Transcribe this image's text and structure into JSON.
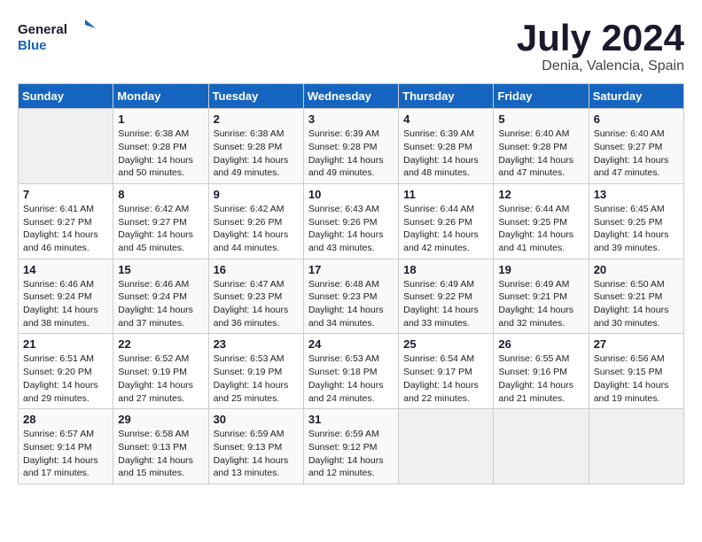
{
  "header": {
    "logo_line1": "General",
    "logo_line2": "Blue",
    "month_title": "July 2024",
    "location": "Denia, Valencia, Spain"
  },
  "weekdays": [
    "Sunday",
    "Monday",
    "Tuesday",
    "Wednesday",
    "Thursday",
    "Friday",
    "Saturday"
  ],
  "weeks": [
    [
      {
        "day": "",
        "sunrise": "",
        "sunset": "",
        "daylight": ""
      },
      {
        "day": "1",
        "sunrise": "Sunrise: 6:38 AM",
        "sunset": "Sunset: 9:28 PM",
        "daylight": "Daylight: 14 hours and 50 minutes."
      },
      {
        "day": "2",
        "sunrise": "Sunrise: 6:38 AM",
        "sunset": "Sunset: 9:28 PM",
        "daylight": "Daylight: 14 hours and 49 minutes."
      },
      {
        "day": "3",
        "sunrise": "Sunrise: 6:39 AM",
        "sunset": "Sunset: 9:28 PM",
        "daylight": "Daylight: 14 hours and 49 minutes."
      },
      {
        "day": "4",
        "sunrise": "Sunrise: 6:39 AM",
        "sunset": "Sunset: 9:28 PM",
        "daylight": "Daylight: 14 hours and 48 minutes."
      },
      {
        "day": "5",
        "sunrise": "Sunrise: 6:40 AM",
        "sunset": "Sunset: 9:28 PM",
        "daylight": "Daylight: 14 hours and 47 minutes."
      },
      {
        "day": "6",
        "sunrise": "Sunrise: 6:40 AM",
        "sunset": "Sunset: 9:27 PM",
        "daylight": "Daylight: 14 hours and 47 minutes."
      }
    ],
    [
      {
        "day": "7",
        "sunrise": "Sunrise: 6:41 AM",
        "sunset": "Sunset: 9:27 PM",
        "daylight": "Daylight: 14 hours and 46 minutes."
      },
      {
        "day": "8",
        "sunrise": "Sunrise: 6:42 AM",
        "sunset": "Sunset: 9:27 PM",
        "daylight": "Daylight: 14 hours and 45 minutes."
      },
      {
        "day": "9",
        "sunrise": "Sunrise: 6:42 AM",
        "sunset": "Sunset: 9:26 PM",
        "daylight": "Daylight: 14 hours and 44 minutes."
      },
      {
        "day": "10",
        "sunrise": "Sunrise: 6:43 AM",
        "sunset": "Sunset: 9:26 PM",
        "daylight": "Daylight: 14 hours and 43 minutes."
      },
      {
        "day": "11",
        "sunrise": "Sunrise: 6:44 AM",
        "sunset": "Sunset: 9:26 PM",
        "daylight": "Daylight: 14 hours and 42 minutes."
      },
      {
        "day": "12",
        "sunrise": "Sunrise: 6:44 AM",
        "sunset": "Sunset: 9:25 PM",
        "daylight": "Daylight: 14 hours and 41 minutes."
      },
      {
        "day": "13",
        "sunrise": "Sunrise: 6:45 AM",
        "sunset": "Sunset: 9:25 PM",
        "daylight": "Daylight: 14 hours and 39 minutes."
      }
    ],
    [
      {
        "day": "14",
        "sunrise": "Sunrise: 6:46 AM",
        "sunset": "Sunset: 9:24 PM",
        "daylight": "Daylight: 14 hours and 38 minutes."
      },
      {
        "day": "15",
        "sunrise": "Sunrise: 6:46 AM",
        "sunset": "Sunset: 9:24 PM",
        "daylight": "Daylight: 14 hours and 37 minutes."
      },
      {
        "day": "16",
        "sunrise": "Sunrise: 6:47 AM",
        "sunset": "Sunset: 9:23 PM",
        "daylight": "Daylight: 14 hours and 36 minutes."
      },
      {
        "day": "17",
        "sunrise": "Sunrise: 6:48 AM",
        "sunset": "Sunset: 9:23 PM",
        "daylight": "Daylight: 14 hours and 34 minutes."
      },
      {
        "day": "18",
        "sunrise": "Sunrise: 6:49 AM",
        "sunset": "Sunset: 9:22 PM",
        "daylight": "Daylight: 14 hours and 33 minutes."
      },
      {
        "day": "19",
        "sunrise": "Sunrise: 6:49 AM",
        "sunset": "Sunset: 9:21 PM",
        "daylight": "Daylight: 14 hours and 32 minutes."
      },
      {
        "day": "20",
        "sunrise": "Sunrise: 6:50 AM",
        "sunset": "Sunset: 9:21 PM",
        "daylight": "Daylight: 14 hours and 30 minutes."
      }
    ],
    [
      {
        "day": "21",
        "sunrise": "Sunrise: 6:51 AM",
        "sunset": "Sunset: 9:20 PM",
        "daylight": "Daylight: 14 hours and 29 minutes."
      },
      {
        "day": "22",
        "sunrise": "Sunrise: 6:52 AM",
        "sunset": "Sunset: 9:19 PM",
        "daylight": "Daylight: 14 hours and 27 minutes."
      },
      {
        "day": "23",
        "sunrise": "Sunrise: 6:53 AM",
        "sunset": "Sunset: 9:19 PM",
        "daylight": "Daylight: 14 hours and 25 minutes."
      },
      {
        "day": "24",
        "sunrise": "Sunrise: 6:53 AM",
        "sunset": "Sunset: 9:18 PM",
        "daylight": "Daylight: 14 hours and 24 minutes."
      },
      {
        "day": "25",
        "sunrise": "Sunrise: 6:54 AM",
        "sunset": "Sunset: 9:17 PM",
        "daylight": "Daylight: 14 hours and 22 minutes."
      },
      {
        "day": "26",
        "sunrise": "Sunrise: 6:55 AM",
        "sunset": "Sunset: 9:16 PM",
        "daylight": "Daylight: 14 hours and 21 minutes."
      },
      {
        "day": "27",
        "sunrise": "Sunrise: 6:56 AM",
        "sunset": "Sunset: 9:15 PM",
        "daylight": "Daylight: 14 hours and 19 minutes."
      }
    ],
    [
      {
        "day": "28",
        "sunrise": "Sunrise: 6:57 AM",
        "sunset": "Sunset: 9:14 PM",
        "daylight": "Daylight: 14 hours and 17 minutes."
      },
      {
        "day": "29",
        "sunrise": "Sunrise: 6:58 AM",
        "sunset": "Sunset: 9:13 PM",
        "daylight": "Daylight: 14 hours and 15 minutes."
      },
      {
        "day": "30",
        "sunrise": "Sunrise: 6:59 AM",
        "sunset": "Sunset: 9:13 PM",
        "daylight": "Daylight: 14 hours and 13 minutes."
      },
      {
        "day": "31",
        "sunrise": "Sunrise: 6:59 AM",
        "sunset": "Sunset: 9:12 PM",
        "daylight": "Daylight: 14 hours and 12 minutes."
      },
      {
        "day": "",
        "sunrise": "",
        "sunset": "",
        "daylight": ""
      },
      {
        "day": "",
        "sunrise": "",
        "sunset": "",
        "daylight": ""
      },
      {
        "day": "",
        "sunrise": "",
        "sunset": "",
        "daylight": ""
      }
    ]
  ]
}
